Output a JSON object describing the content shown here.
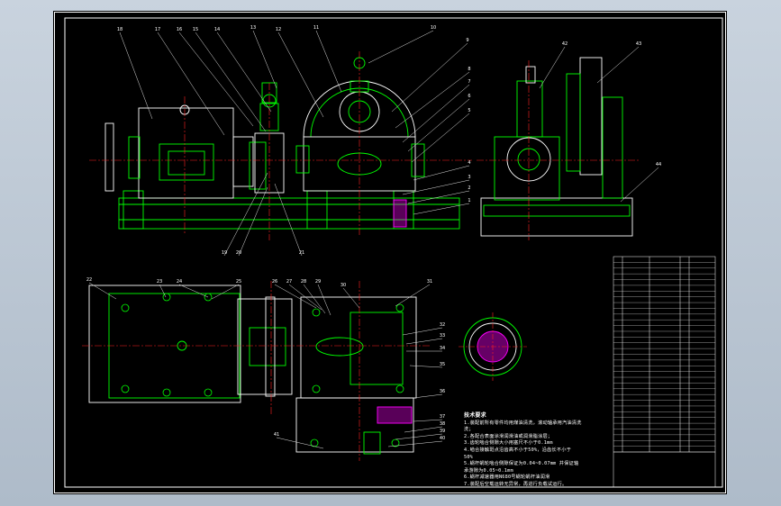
{
  "background": "#b9c5d1",
  "sheet_color": "#000000",
  "colors": {
    "outline": "#ffffff",
    "part": "#00ff00",
    "center": "#ff2020",
    "hatch": "#ff00ff",
    "dim": "#00ffff",
    "leader": "#e0e0e0"
  },
  "callouts_top": [
    "18",
    "17",
    "16",
    "15",
    "14",
    "13",
    "12",
    "11",
    "10",
    "9",
    "8",
    "7",
    "6",
    "5",
    "4",
    "3",
    "2",
    "1",
    "19",
    "20",
    "21",
    "42",
    "43",
    "44"
  ],
  "callouts_plan": [
    "22",
    "23",
    "24",
    "25",
    "26",
    "27",
    "28",
    "29",
    "30",
    "31",
    "32",
    "33",
    "34",
    "35",
    "36",
    "37",
    "38",
    "39",
    "40",
    "41"
  ],
  "technical_notes": {
    "title": "技术要求",
    "lines": [
      "1.装配前所有零件均用煤油清洗，滚动轴承用汽油清洗",
      "洗；",
      "2.各配合表面涂滑润滑油或润滑脂涂层；",
      "3.齿轮啮合侧隙大小用塞尺不小于0.1mm",
      "4.啮合接触斑点沿齿高不小于50%，沿齿长不小于",
      "50%",
      "5.蜗杆蜗轮啮合侧隙保证为0.04~0.07mm 并保证轴",
      "承游隙为0.05~0.1mm",
      "6.蜗杆减速器用N680号蜗轮蜗杆油润滑",
      "7.装配后空载运转无异常，再进行负载试运行。"
    ]
  },
  "bom_rows": 34
}
